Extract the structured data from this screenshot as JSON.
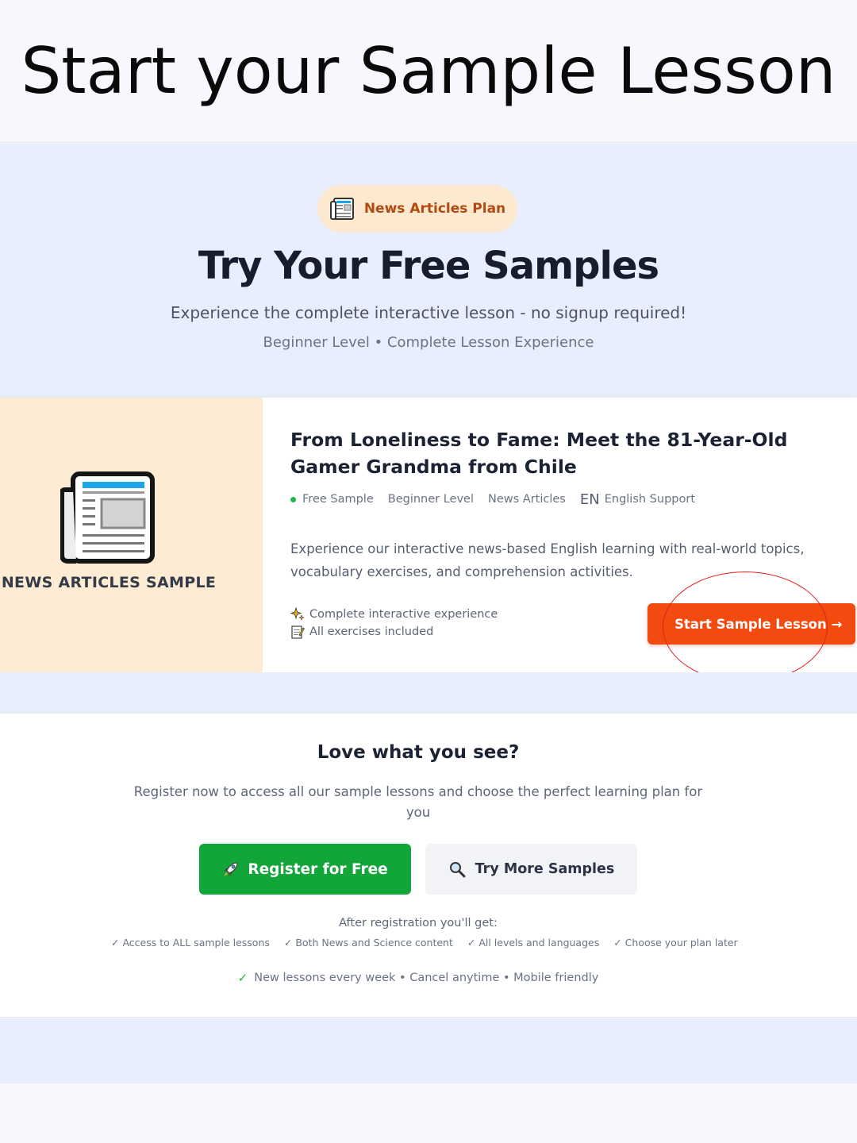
{
  "banner": {
    "title": "Start your Sample Lesson"
  },
  "hero": {
    "plan_label": "News Articles Plan",
    "title": "Try Your Free Samples",
    "subtitle": "Experience the complete interactive lesson - no signup required!",
    "meta": "Beginner Level • Complete Lesson Experience"
  },
  "card": {
    "side_label": "NEWS ARTICLES SAMPLE",
    "title": "From Loneliness to Fame: Meet the 81-Year-Old Gamer Grandma from Chile",
    "tags": {
      "free": "Free Sample",
      "level": "Beginner Level",
      "category": "News Articles",
      "lang_code": "EN",
      "lang_support": "English Support"
    },
    "description": "Experience our interactive news-based English learning with real-world topics, vocabulary exercises, and comprehension activities.",
    "features": [
      "Complete interactive experience",
      "All exercises included"
    ],
    "start_button": "Start Sample Lesson →"
  },
  "cta": {
    "title": "Love what you see?",
    "text": "Register now to access all our sample lessons and choose the perfect learning plan for you",
    "register_button": "Register for Free",
    "more_button": "Try More Samples",
    "after_label": "After registration you'll get:",
    "benefits": [
      "✓ Access to ALL sample lessons",
      "✓ Both News and Science content",
      "✓ All levels and languages",
      "✓ Choose your plan later"
    ],
    "footer_check": "✓",
    "footer": "New lessons every week • Cancel anytime • Mobile friendly"
  },
  "colors": {
    "accent_orange": "#f24a0f",
    "accent_green": "#12a63a",
    "annotation_red": "#e22020"
  }
}
